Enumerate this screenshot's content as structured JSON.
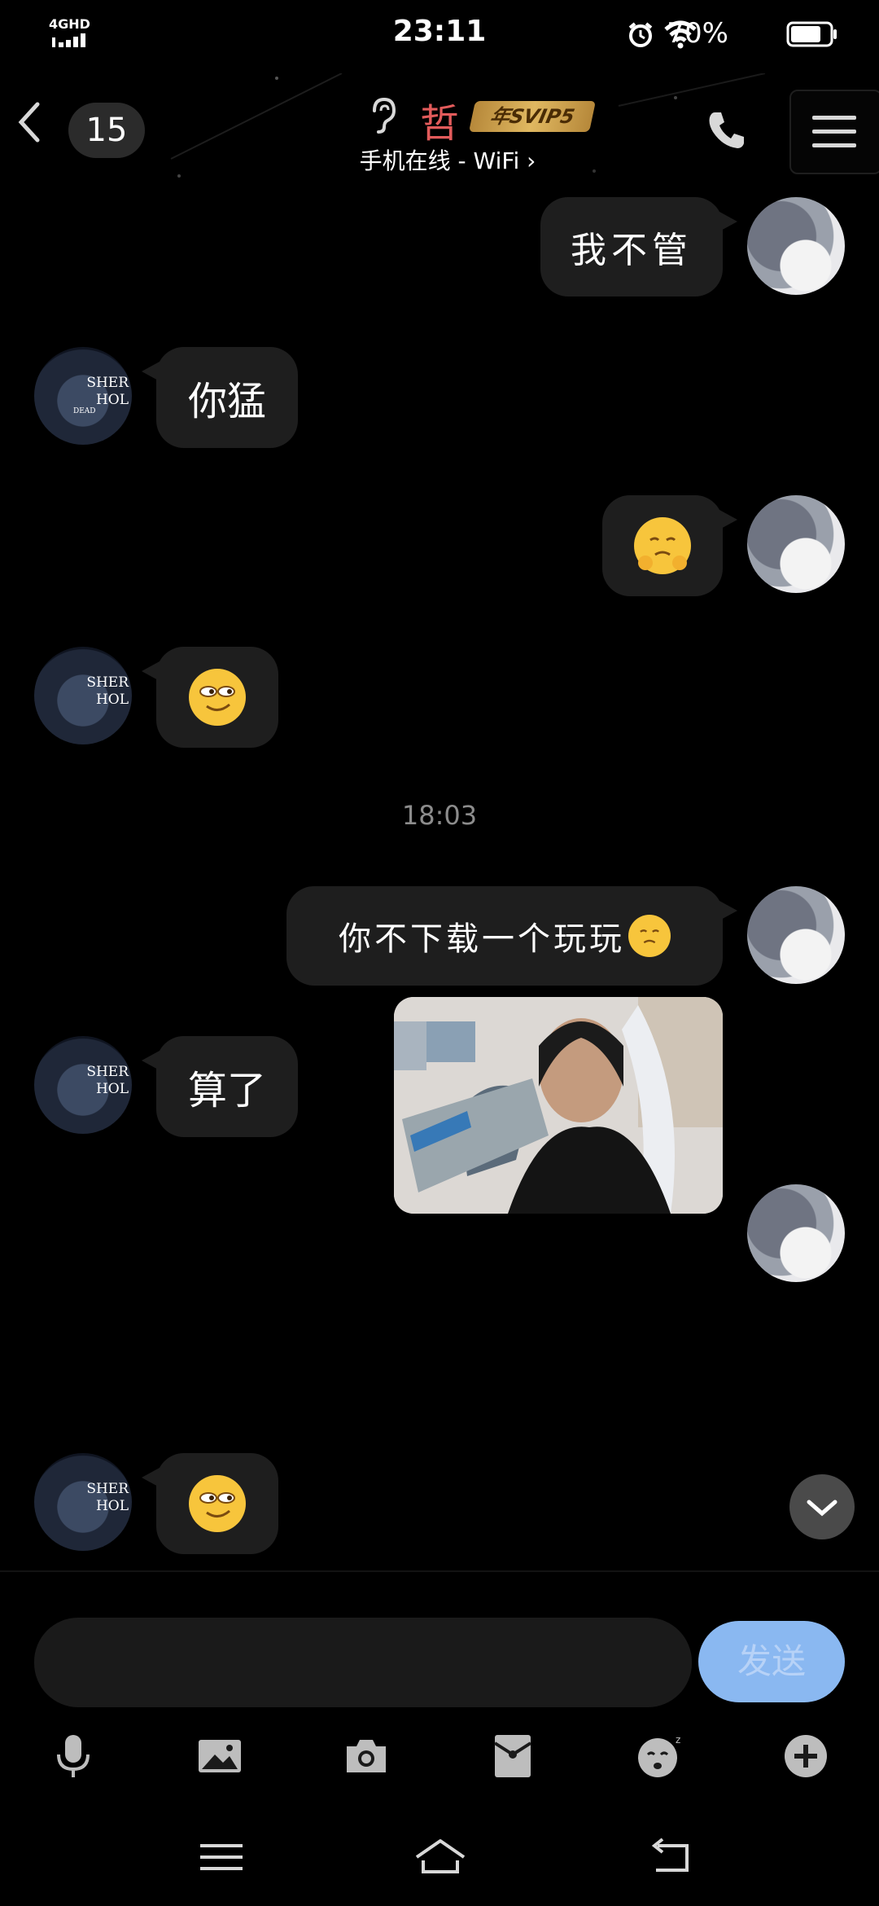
{
  "status_bar": {
    "network": "4GHD",
    "time": "23:11",
    "battery_percent": "70%"
  },
  "header": {
    "unread_count": "15",
    "contact_name": "哲",
    "svip_label": "年SVIP5",
    "subtitle": "手机在线 - WiFi ›"
  },
  "messages": [
    {
      "side": "right",
      "type": "text",
      "text": "我不管"
    },
    {
      "side": "left",
      "type": "text",
      "text": "你猛"
    },
    {
      "side": "right",
      "type": "emoji",
      "emoji": "pouting-face"
    },
    {
      "side": "left",
      "type": "emoji",
      "emoji": "smirk-face"
    },
    {
      "type": "timestamp",
      "text": "18:03"
    },
    {
      "side": "right",
      "type": "text",
      "text": "你不下载一个玩玩",
      "emoji": "pouting-face"
    },
    {
      "side": "left",
      "type": "text",
      "text": "算了"
    },
    {
      "side": "right",
      "type": "image"
    },
    {
      "side": "left",
      "type": "emoji",
      "emoji": "smirk-face"
    }
  ],
  "avatars": {
    "friend_book_title": "SHER\nHOL",
    "friend_book_dead": "DEAD"
  },
  "input": {
    "placeholder": "",
    "send_label": "发送"
  },
  "toolbar": [
    "microphone-icon",
    "image-icon",
    "camera-icon",
    "red-packet-icon",
    "sticker-icon",
    "plus-icon"
  ],
  "navbar": [
    "menu-icon",
    "home-icon",
    "back-icon"
  ],
  "colors": {
    "name_red": "#e25b5b",
    "svip_gold": "#d9ae55",
    "bubble": "#1e1e1e",
    "send_blue": "#8ab8f1"
  }
}
